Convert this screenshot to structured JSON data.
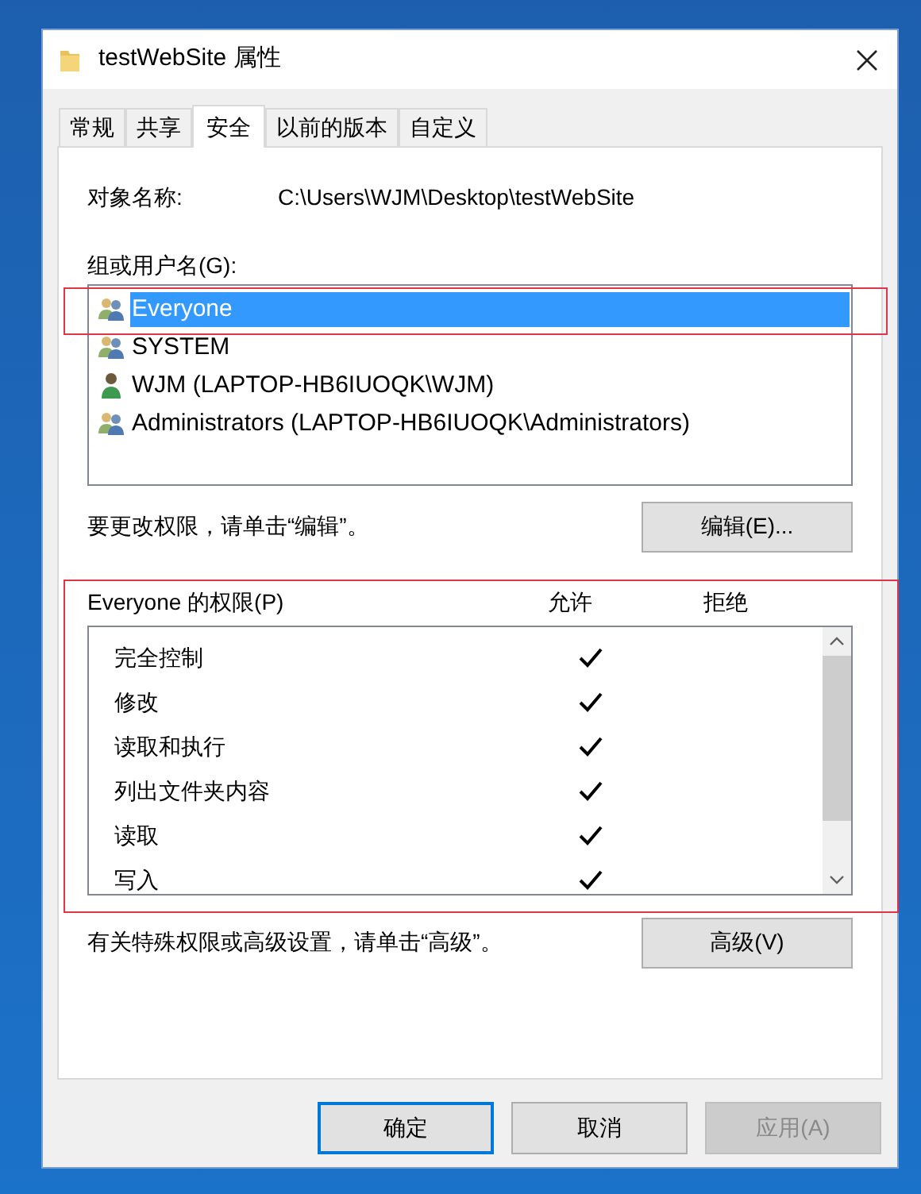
{
  "window": {
    "title": "testWebSite 属性"
  },
  "tabs": [
    {
      "label": "常规",
      "selected": false
    },
    {
      "label": "共享",
      "selected": false
    },
    {
      "label": "安全",
      "selected": true
    },
    {
      "label": "以前的版本",
      "selected": false
    },
    {
      "label": "自定义",
      "selected": false
    }
  ],
  "object_name": {
    "label": "对象名称:",
    "value": "C:\\Users\\WJM\\Desktop\\testWebSite"
  },
  "users": {
    "label": "组或用户名(G):",
    "items": [
      {
        "name": "Everyone",
        "kind": "group",
        "selected": true
      },
      {
        "name": "SYSTEM",
        "kind": "group",
        "selected": false
      },
      {
        "name": "WJM (LAPTOP-HB6IUOQK\\WJM)",
        "kind": "user",
        "selected": false
      },
      {
        "name": "Administrators (LAPTOP-HB6IUOQK\\Administrators)",
        "kind": "group",
        "selected": false
      }
    ]
  },
  "edit_hint": "要更改权限，请单击“编辑”。",
  "edit_button": "编辑(E)...",
  "permissions": {
    "title": "Everyone 的权限(P)",
    "allow_header": "允许",
    "deny_header": "拒绝",
    "items": [
      {
        "name": "完全控制",
        "allow": true,
        "deny": false
      },
      {
        "name": "修改",
        "allow": true,
        "deny": false
      },
      {
        "name": "读取和执行",
        "allow": true,
        "deny": false
      },
      {
        "name": "列出文件夹内容",
        "allow": true,
        "deny": false
      },
      {
        "name": "读取",
        "allow": true,
        "deny": false
      },
      {
        "name": "写入",
        "allow": true,
        "deny": false
      }
    ]
  },
  "advanced_hint": "有关特殊权限或高级设置，请单击“高级”。",
  "advanced_button": "高级(V)",
  "buttons": [
    {
      "label": "确定",
      "kind": "default",
      "disabled": false
    },
    {
      "label": "取消",
      "kind": "normal",
      "disabled": false
    },
    {
      "label": "应用(A)",
      "kind": "normal",
      "disabled": true
    }
  ]
}
